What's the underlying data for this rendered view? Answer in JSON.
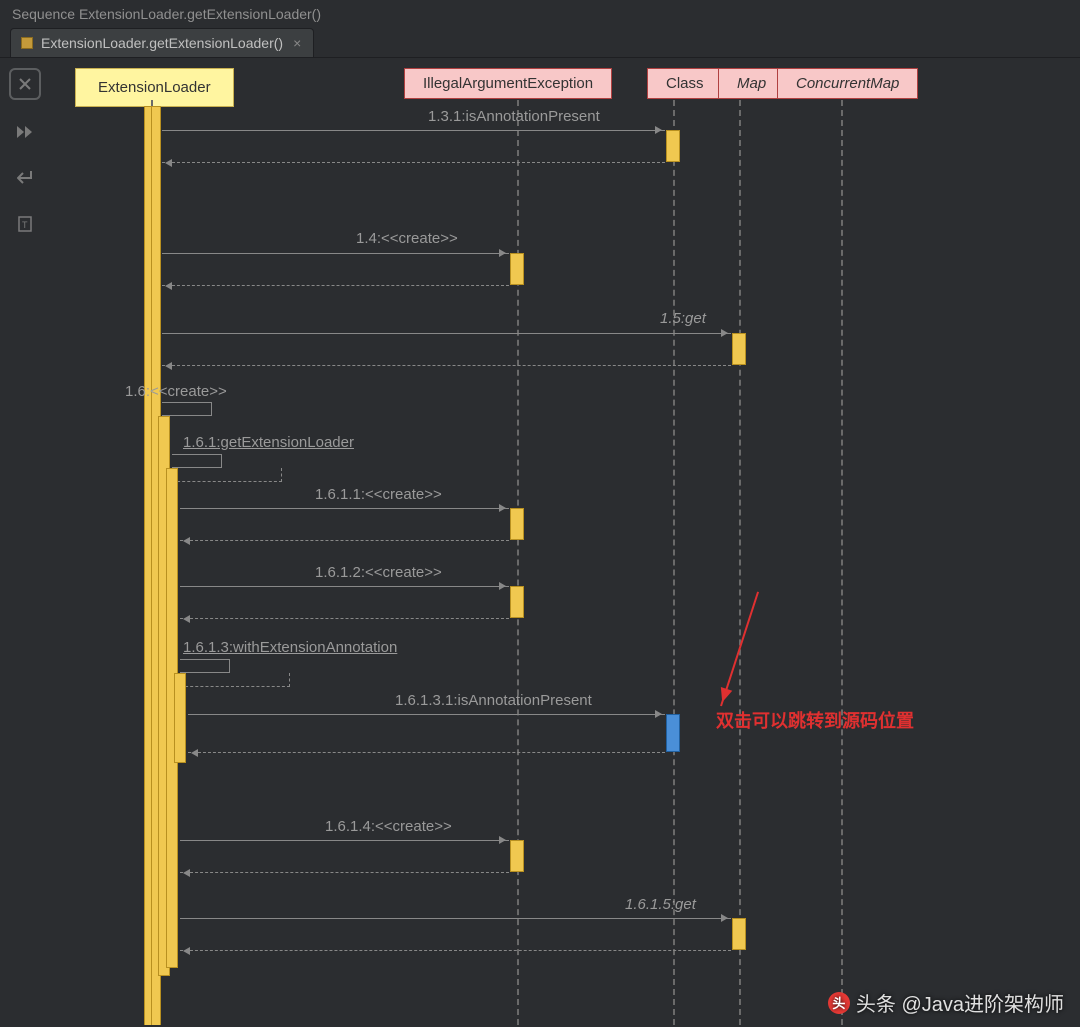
{
  "window": {
    "title": "Sequence ExtensionLoader.getExtensionLoader()"
  },
  "tab": {
    "label": "ExtensionLoader.getExtensionLoader()"
  },
  "actors": {
    "extensionLoader": "ExtensionLoader",
    "illegalArg": "IllegalArgumentException",
    "class_": "Class",
    "map": "Map",
    "concurrentMap": "ConcurrentMap"
  },
  "messages": {
    "m131": "1.3.1:isAnnotationPresent",
    "m14": "1.4:<<create>>",
    "m15": "1.5:get",
    "m16": "1.6:<<create>>",
    "m161": "1.6.1:getExtensionLoader",
    "m1611": "1.6.1.1:<<create>>",
    "m1612": "1.6.1.2:<<create>>",
    "m1613": "1.6.1.3:withExtensionAnnotation",
    "m16131": "1.6.1.3.1:isAnnotationPresent",
    "m1614": "1.6.1.4:<<create>>",
    "m1615": "1.6.1.5:get"
  },
  "annotation": "双击可以跳转到源码位置",
  "watermark": "头条 @Java进阶架构师"
}
